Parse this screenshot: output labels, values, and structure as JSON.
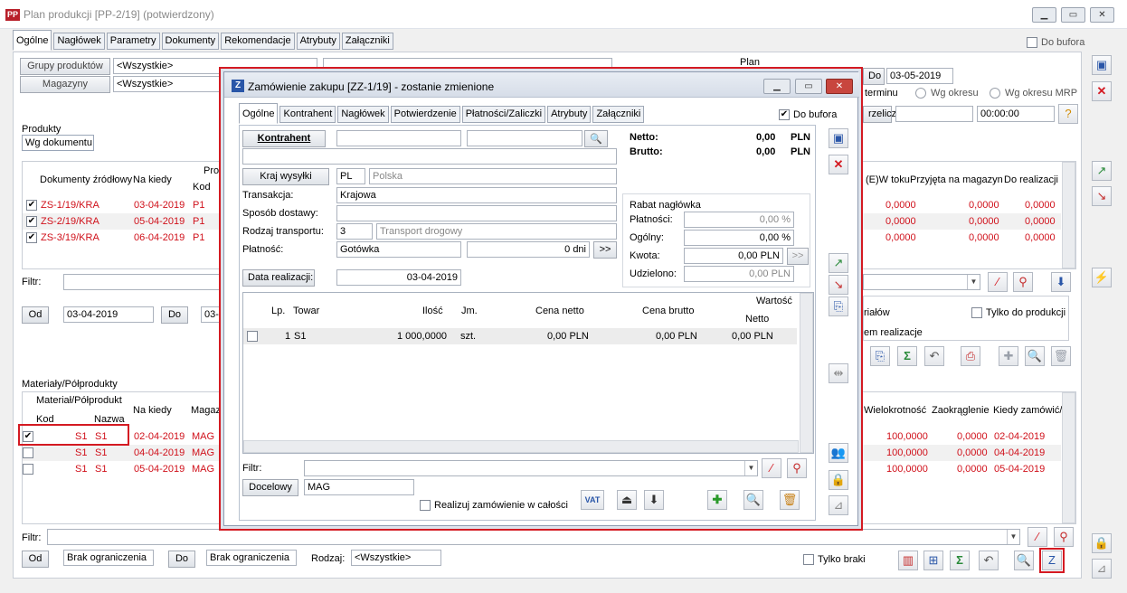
{
  "main": {
    "title": "Plan produkcji [PP-2/19]  (potwierdzony)",
    "tabs": [
      "Ogólne",
      "Nagłówek",
      "Parametry",
      "Dokumenty",
      "Rekomendacje",
      "Atrybuty",
      "Załączniki"
    ],
    "do_bufora": "Do bufora",
    "grupy_label": "Grupy produktów",
    "grupy_value": "<Wszystkie>",
    "magazyny_label": "Magazyny",
    "magazyny_value": "<Wszystkie>",
    "plan_label": "Plan",
    "do_label": "Do",
    "plan_date": "03-05-2019",
    "terminu": "terminu",
    "wg_okresu": "Wg okresu",
    "wg_okresu_mrp": "Wg okresu MRP",
    "przelicz": "rzelicz",
    "time": "00:00:00",
    "produkty_label": "Produkty",
    "wg_dokumentu": "Wg dokumentu",
    "prod_headers": {
      "doc": "Dokumenty źródłowy",
      "na_kiedy": "Na kiedy",
      "pro": "Pro",
      "kod": "Kod",
      "w_toku": "(E)W toku",
      "przyjeta": "Przyjęta na magazyn",
      "do_realizacji": "Do realizacji"
    },
    "prod_rows": [
      {
        "doc": "ZS-1/19/KRA",
        "date": "03-04-2019",
        "kod": "P1",
        "w_toku": "0,0000",
        "przyjeta": "0,0000",
        "do_real": "0,0000"
      },
      {
        "doc": "ZS-2/19/KRA",
        "date": "05-04-2019",
        "kod": "P1",
        "w_toku": "0,0000",
        "przyjeta": "0,0000",
        "do_real": "0,0000"
      },
      {
        "doc": "ZS-3/19/KRA",
        "date": "06-04-2019",
        "kod": "P1",
        "w_toku": "0,0000",
        "przyjeta": "0,0000",
        "do_real": "0,0000"
      }
    ],
    "filtr": "Filtr:",
    "od": "Od",
    "od_date": "03-04-2019",
    "do_btn": "Do",
    "do_date_partial": "03-",
    "rialow": "riałów",
    "tylko_do_produkcji": "Tylko do produkcji",
    "em_realizacje": "em realizacje",
    "materialy_label": "Materiały/Półprodukty",
    "mat_headers": {
      "mat": "Materiał/Półprodukt",
      "kod": "Kod",
      "nazwa": "Nazwa",
      "na_kiedy": "Na kiedy",
      "magaz": "Magaz",
      "wielokrotnosc": "Wielokrotność",
      "zaokraglenie": "Zaokrąglenie",
      "kiedy": "Kiedy zamówić/złe"
    },
    "mat_rows": [
      {
        "kod": "S1",
        "nazwa": "S1",
        "date": "02-04-2019",
        "mag": "MAG",
        "wiel": "100,0000",
        "zaok": "0,0000",
        "kiedy": "02-04-2019"
      },
      {
        "kod": "S1",
        "nazwa": "S1",
        "date": "04-04-2019",
        "mag": "MAG",
        "wiel": "100,0000",
        "zaok": "0,0000",
        "kiedy": "04-04-2019"
      },
      {
        "kod": "S1",
        "nazwa": "S1",
        "date": "05-04-2019",
        "mag": "MAG",
        "wiel": "100,0000",
        "zaok": "0,0000",
        "kiedy": "05-04-2019"
      }
    ],
    "brak1": "Brak ograniczenia",
    "brak2": "Brak ograniczenia",
    "rodzaj": "Rodzaj:",
    "rodzaj_value": "<Wszystkie>",
    "tylko_braki": "Tylko braki"
  },
  "dialog": {
    "title": "Zamówienie zakupu [ZZ-1/19] - zostanie zmienione",
    "tabs": [
      "Ogólne",
      "Kontrahent",
      "Nagłówek",
      "Potwierdzenie",
      "Płatności/Zaliczki",
      "Atrybuty",
      "Załączniki"
    ],
    "do_bufora": "Do bufora",
    "kontrahent_btn": "Kontrahent",
    "netto_label": "Netto:",
    "netto_value": "0,00",
    "brutto_label": "Brutto:",
    "brutto_value": "0,00",
    "currency": "PLN",
    "kraj_btn": "Kraj wysyłki",
    "kraj_code": "PL",
    "kraj_name": "Polska",
    "transakcja_label": "Transakcja:",
    "transakcja_value": "Krajowa",
    "sposob_label": "Sposób dostawy:",
    "rodzaj_label": "Rodzaj transportu:",
    "rodzaj_num": "3",
    "rodzaj_value": "Transport drogowy",
    "platnosc_label": "Płatność:",
    "platnosc_value": "Gotówka",
    "dni": "0 dni",
    "rabat_label": "Rabat nagłówka",
    "platnosci_label": "Płatności:",
    "platnosci_value": "0,00 %",
    "ogolny_label": "Ogólny:",
    "ogolny_value": "0,00 %",
    "kwota_label": "Kwota:",
    "kwota_value": "0,00 PLN",
    "udzielono_label": "Udzielono:",
    "udzielono_value": "0,00 PLN",
    "data_real_btn": "Data realizacji:",
    "data_real_value": "03-04-2019",
    "grid_headers": {
      "lp": "Lp.",
      "towar": "Towar",
      "ilosc": "Ilość",
      "jm": "Jm.",
      "cena_netto": "Cena netto",
      "cena_brutto": "Cena brutto",
      "wartosc": "Wartość",
      "netto": "Netto"
    },
    "grid_row": {
      "lp": "1",
      "towar": "S1",
      "ilosc": "1 000,0000",
      "jm": "szt.",
      "cena_netto": "0,00 PLN",
      "cena_brutto": "0,00 PLN",
      "netto": "0,00 PLN"
    },
    "filtr": "Filtr:",
    "docelowy_btn": "Docelowy",
    "docelowy_value": "MAG",
    "realizuj": "Realizuj zamówienie w całości",
    "vat_label": "VAT"
  },
  "colors": {
    "accent_red": "#d41a22",
    "row_red": "#d0101a"
  }
}
